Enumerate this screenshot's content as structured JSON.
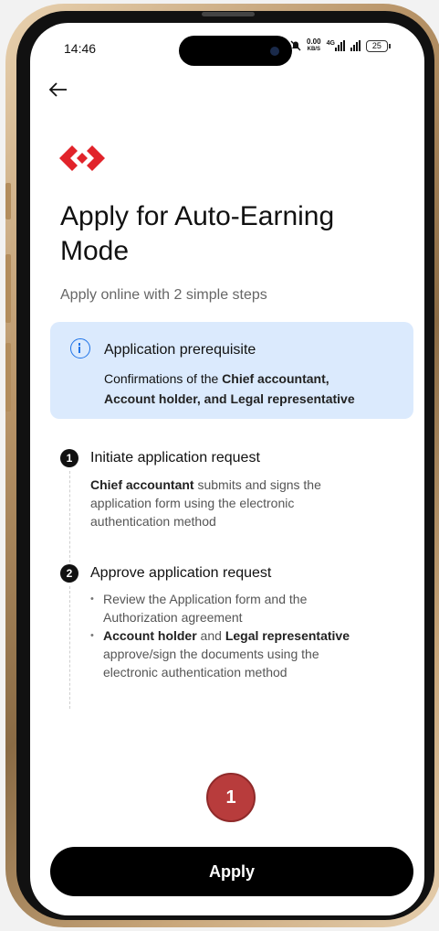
{
  "status_bar": {
    "time": "14:46",
    "net_speed": "0.00",
    "net_unit": "KB/S",
    "net_type": "4G",
    "battery": "25"
  },
  "header": {
    "back_icon": "arrow-left-icon",
    "logo": "red-diamond-logo"
  },
  "main": {
    "title": "Apply for Auto-Earning Mode",
    "subtitle": "Apply online with 2 simple steps"
  },
  "prerequisite": {
    "icon": "info-icon",
    "title": "Application prerequisite",
    "text_prefix": "Confirmations of the ",
    "text_bold1": "Chief accountant,",
    "text_bold2": "Account holder, and Legal representative"
  },
  "steps": [
    {
      "number": "1",
      "title": "Initiate application request",
      "text_bold": "Chief accountant",
      "text_rest": " submits and signs the application form using the electronic authentication method"
    },
    {
      "number": "2",
      "title": "Approve application request",
      "bullet1": "Review the Application form and the Authorization agreement",
      "bullet2_bold1": "Account holder",
      "bullet2_mid": " and ",
      "bullet2_bold2": "Legal representative",
      "bullet2_rest": " approve/sign the documents using the electronic authentication method"
    }
  ],
  "annotation_marker": "1",
  "apply_button": {
    "label": "Apply"
  },
  "colors": {
    "accent_blue": "#1e73e8",
    "info_bg": "#dbeafd",
    "brand_red": "#e1232a",
    "marker_red": "#b83c3c",
    "button_black": "#000000"
  }
}
